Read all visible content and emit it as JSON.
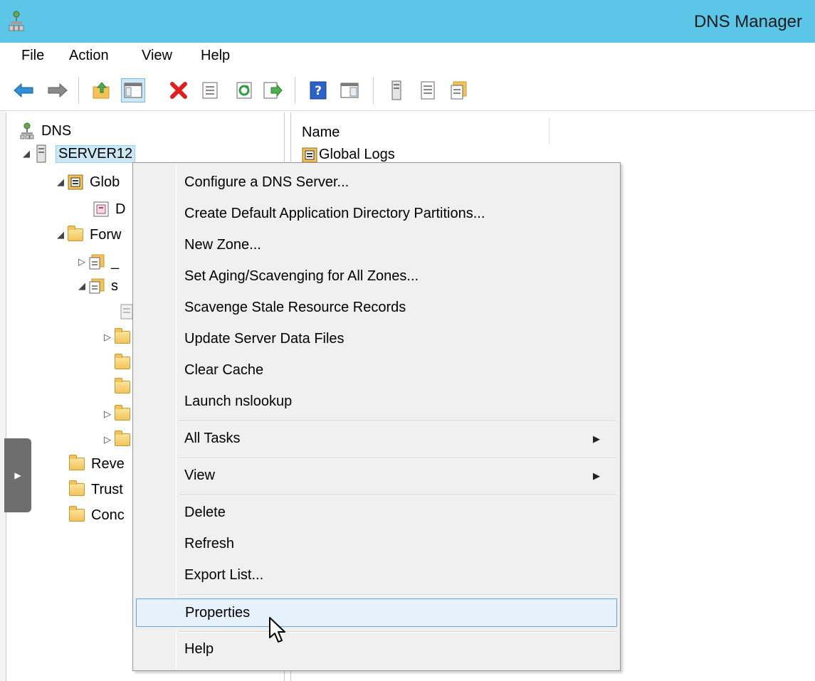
{
  "window": {
    "title": "DNS Manager",
    "titlebar_color": "#5bc6e8"
  },
  "menubar": {
    "items": [
      "File",
      "Action",
      "View",
      "Help"
    ]
  },
  "toolbar": {
    "buttons": [
      "back-arrow-icon",
      "forward-arrow-icon",
      "up-level-icon",
      "show-hide-console-tree-icon",
      "delete-icon",
      "properties-icon",
      "refresh-icon",
      "export-list-icon",
      "help-icon",
      "show-action-pane-icon",
      "server-icon",
      "list-view-icon",
      "zone-icon"
    ]
  },
  "tree": {
    "items": [
      {
        "label": "DNS",
        "icon": "dns-icon",
        "expander": ""
      },
      {
        "label": "SERVER12",
        "icon": "server-icon",
        "expander": "◢",
        "selected": true
      },
      {
        "label": "Glob",
        "icon": "global-logs-icon",
        "expander": "◢"
      },
      {
        "label": "D",
        "icon": "dns-log-icon",
        "expander": ""
      },
      {
        "label": "Forw",
        "icon": "folder-icon",
        "expander": "◢"
      },
      {
        "label": "_",
        "icon": "zone-icon",
        "expander": "▷"
      },
      {
        "label": "s",
        "icon": "zone-icon",
        "expander": "◢"
      },
      {
        "label": "",
        "icon": "record-icon",
        "expander": ""
      },
      {
        "label": "",
        "icon": "folder-icon",
        "expander": "▷"
      },
      {
        "label": "",
        "icon": "folder-icon",
        "expander": ""
      },
      {
        "label": "",
        "icon": "folder-icon",
        "expander": ""
      },
      {
        "label": "",
        "icon": "folder-icon",
        "expander": "▷"
      },
      {
        "label": "",
        "icon": "folder-icon",
        "expander": "▷"
      },
      {
        "label": "Reve",
        "icon": "folder-icon",
        "expander": ""
      },
      {
        "label": "Trust",
        "icon": "folder-icon",
        "expander": ""
      },
      {
        "label": "Conc",
        "icon": "folder-icon",
        "expander": ""
      }
    ]
  },
  "list": {
    "column_header": "Name",
    "rows": [
      {
        "name": "Global Logs",
        "icon": "global-logs-icon"
      }
    ]
  },
  "context_menu": {
    "items": [
      {
        "label": "Configure a DNS Server..."
      },
      {
        "label": "Create Default Application Directory Partitions..."
      },
      {
        "label": "New Zone..."
      },
      {
        "label": "Set Aging/Scavenging for All Zones..."
      },
      {
        "label": "Scavenge Stale Resource Records"
      },
      {
        "label": "Update Server Data Files"
      },
      {
        "label": "Clear Cache"
      },
      {
        "label": "Launch nslookup"
      },
      {
        "label": "All Tasks",
        "submenu": true
      },
      {
        "label": "View",
        "submenu": true
      },
      {
        "label": "Delete"
      },
      {
        "label": "Refresh"
      },
      {
        "label": "Export List..."
      },
      {
        "label": "Properties",
        "highlighted": true
      },
      {
        "label": "Help"
      }
    ],
    "submenu_arrow": "▶",
    "highlight_color": "#e5f1fb"
  }
}
